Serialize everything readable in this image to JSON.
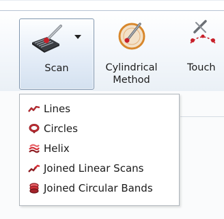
{
  "ribbon": {
    "buttons": [
      {
        "id": "scan",
        "label": "Scan",
        "icon": "scan-icon",
        "has_dropdown": true,
        "selected": true
      },
      {
        "id": "cylindrical",
        "label_line1": "Cylindrical",
        "label_line2": "Method",
        "icon": "cylindrical-method-icon"
      },
      {
        "id": "touch",
        "label": "Touch",
        "icon": "touch-icon"
      }
    ]
  },
  "scan_menu": {
    "items": [
      {
        "label": "Lines",
        "icon": "lines-icon"
      },
      {
        "label": "Circles",
        "icon": "circles-icon"
      },
      {
        "label": "Helix",
        "icon": "helix-icon"
      },
      {
        "label": "Joined Linear Scans",
        "icon": "joined-linear-scans-icon"
      },
      {
        "label": "Joined Circular Bands",
        "icon": "joined-circular-bands-icon"
      }
    ]
  },
  "colors": {
    "accent_red": "#c8202a",
    "cylinder_orange": "#d8872c",
    "probe_gray": "#6b6f75"
  }
}
